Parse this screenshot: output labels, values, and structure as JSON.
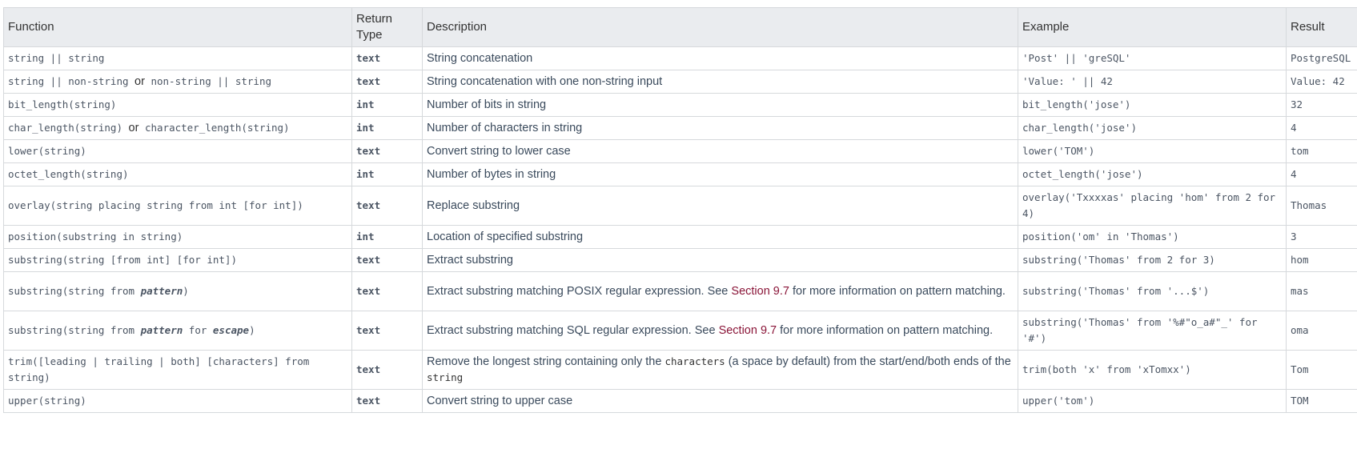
{
  "headers": {
    "function": "Function",
    "return_type_line1": "Return",
    "return_type_line2": "Type",
    "description": "Description",
    "example": "Example",
    "result": "Result"
  },
  "rows": [
    {
      "function": "string || string",
      "return_type": "text",
      "description": "String concatenation",
      "example": "'Post' || 'greSQL'",
      "result": "PostgreSQL"
    },
    {
      "function_a": "string || non-string",
      "function_joiner": "or",
      "function_b": "non-string || string",
      "return_type": "text",
      "description": "String concatenation with one non-string input",
      "example": "'Value: ' || 42",
      "result": "Value: 42"
    },
    {
      "function": "bit_length(string)",
      "return_type": "int",
      "description": "Number of bits in string",
      "example": "bit_length('jose')",
      "result": "32"
    },
    {
      "function_a": "char_length(string)",
      "function_joiner": "or",
      "function_b": "character_length(string)",
      "return_type": "int",
      "description": "Number of characters in string",
      "example": "char_length('jose')",
      "result": "4"
    },
    {
      "function": "lower(string)",
      "return_type": "text",
      "description": "Convert string to lower case",
      "example": "lower('TOM')",
      "result": "tom"
    },
    {
      "function": "octet_length(string)",
      "return_type": "int",
      "description": "Number of bytes in string",
      "example": "octet_length('jose')",
      "result": "4"
    },
    {
      "function": "overlay(string placing string from int [for int])",
      "return_type": "text",
      "description": "Replace substring",
      "example": "overlay('Txxxxas' placing 'hom' from 2 for 4)",
      "result": "Thomas"
    },
    {
      "function": "position(substring in string)",
      "return_type": "int",
      "description": "Location of specified substring",
      "example": "position('om' in 'Thomas')",
      "result": "3"
    },
    {
      "function": "substring(string [from int] [for int])",
      "return_type": "text",
      "description": "Extract substring",
      "example": "substring('Thomas' from 2 for 3)",
      "result": "hom"
    },
    {
      "function_pre": "substring(string from ",
      "function_kw": "pattern",
      "function_post": ")",
      "return_type": "text",
      "description_pre": "Extract substring matching POSIX regular expression. See ",
      "description_link": "Section 9.7",
      "description_post": " for more information on pattern matching.",
      "example": "substring('Thomas' from '...$')",
      "result": "mas"
    },
    {
      "function_pre": "substring(string from ",
      "function_kw": "pattern",
      "function_mid": " for ",
      "function_kw2": "escape",
      "function_post": ")",
      "return_type": "text",
      "description_pre": "Extract substring matching SQL regular expression. See ",
      "description_link": "Section 9.7",
      "description_post": " for more information on pattern matching.",
      "example": "substring('Thomas' from '%#\"o_a#\"_' for '#')",
      "result": "oma"
    },
    {
      "function": "trim([leading | trailing | both] [characters] from string)",
      "return_type": "text",
      "description_pre": "Remove the longest string containing only the ",
      "description_code1": "characters",
      "description_mid": " (a space by default) from the start/end/both ends of the ",
      "description_code2": "string",
      "example": "trim(both 'x' from 'xTomxx')",
      "result": "Tom"
    },
    {
      "function": "upper(string)",
      "return_type": "text",
      "description": "Convert string to upper case",
      "example": "upper('tom')",
      "result": "TOM"
    }
  ]
}
